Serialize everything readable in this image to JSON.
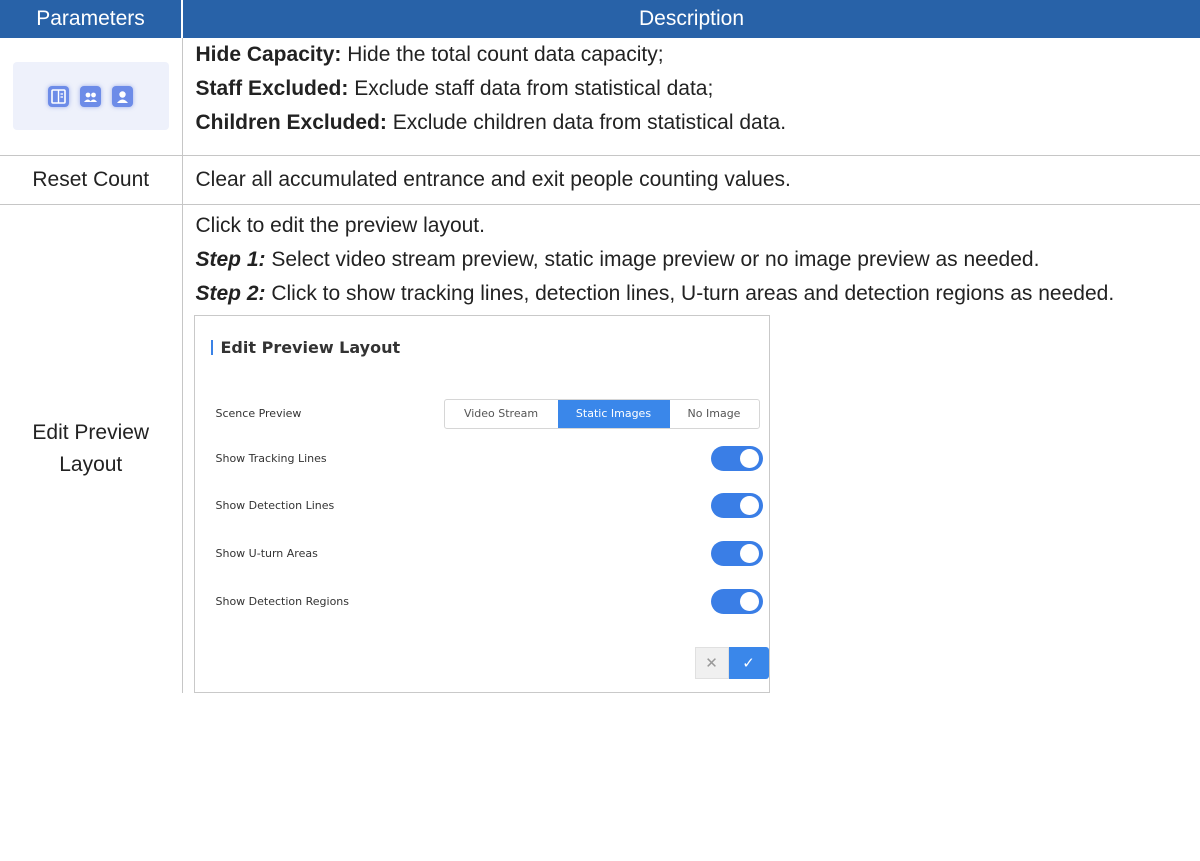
{
  "header": {
    "col1": "Parameters",
    "col2": "Description"
  },
  "rows": [
    {
      "icons": [
        "hide-capacity-icon",
        "staff-excluded-icon",
        "children-excluded-icon"
      ],
      "items": [
        {
          "term": "Hide Capacity:",
          "text": " Hide the total count data capacity;"
        },
        {
          "term": "Staff Excluded:",
          "text": " Exclude staff data from statistical data;"
        },
        {
          "term": "Children Excluded:",
          "text": " Exclude children data from statistical data."
        }
      ]
    },
    {
      "param": "Reset Count",
      "description": "Clear all accumulated entrance and exit people counting values."
    },
    {
      "param": "Edit Preview Layout",
      "intro": "Click to edit the preview layout.",
      "steps": [
        {
          "label": "Step 1:",
          "text": " Select video stream preview, static image preview or no image preview as needed."
        },
        {
          "label": "Step 2:",
          "text": " Click to show tracking lines, detection lines, U-turn areas and detection regions as needed."
        }
      ],
      "panel": {
        "title": "Edit Preview Layout",
        "scene_label": "Scence Preview",
        "scene_options": [
          "Video Stream",
          "Static Images",
          "No Image"
        ],
        "scene_selected": "Static Images",
        "toggles": [
          {
            "label": "Show Tracking Lines",
            "on": true
          },
          {
            "label": "Show Detection Lines",
            "on": true
          },
          {
            "label": "Show U-turn Areas",
            "on": true
          },
          {
            "label": "Show Detection Regions",
            "on": true
          }
        ],
        "cancel_glyph": "✕",
        "confirm_glyph": "✓"
      }
    }
  ],
  "colors": {
    "header_bg": "#2862a8",
    "accent": "#3a87ea"
  }
}
